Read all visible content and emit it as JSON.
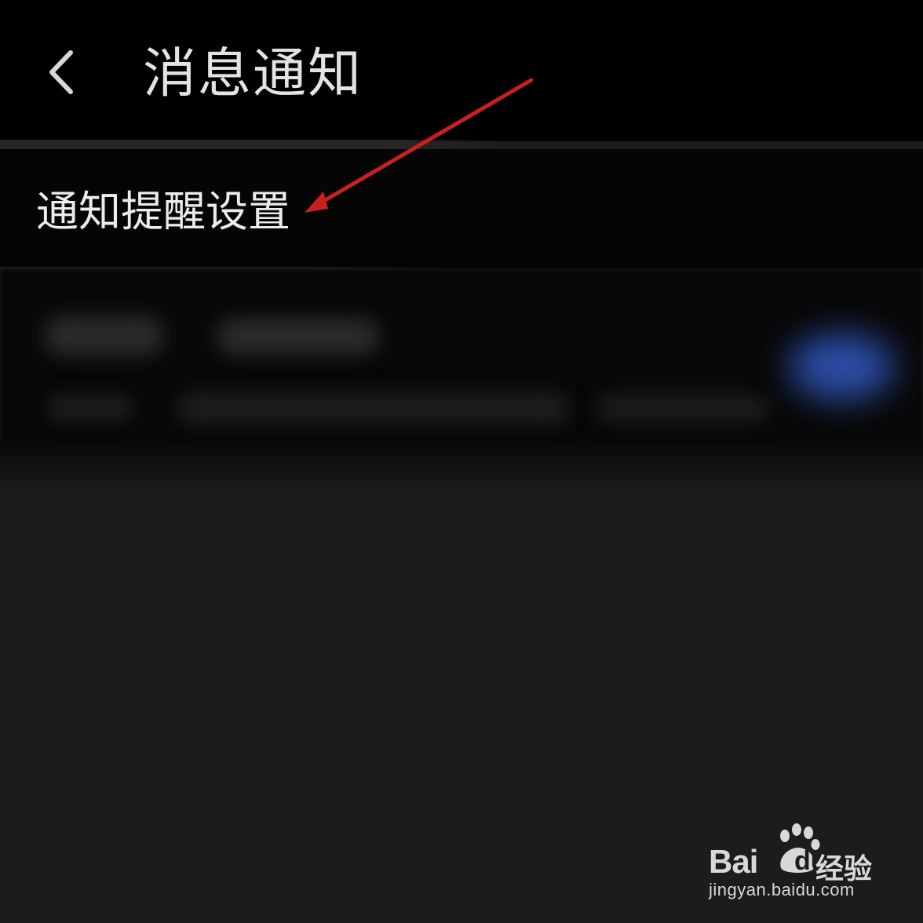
{
  "header": {
    "back_icon": "chevron-left-icon",
    "title": "消息通知"
  },
  "settings": {
    "label": "通知提醒设置"
  },
  "blurred_item": {
    "toggle_color": "#2c4ea8",
    "toggle_state": "on"
  },
  "annotation": {
    "arrow_color": "#c8201e"
  },
  "watermark": {
    "bai": "Bai",
    "du": "du",
    "jingyan": "经验",
    "url": "jingyan.baidu.com"
  },
  "colors": {
    "background": "#1c1c1c",
    "header_bg": "#000000",
    "text": "#e3e3e3"
  }
}
